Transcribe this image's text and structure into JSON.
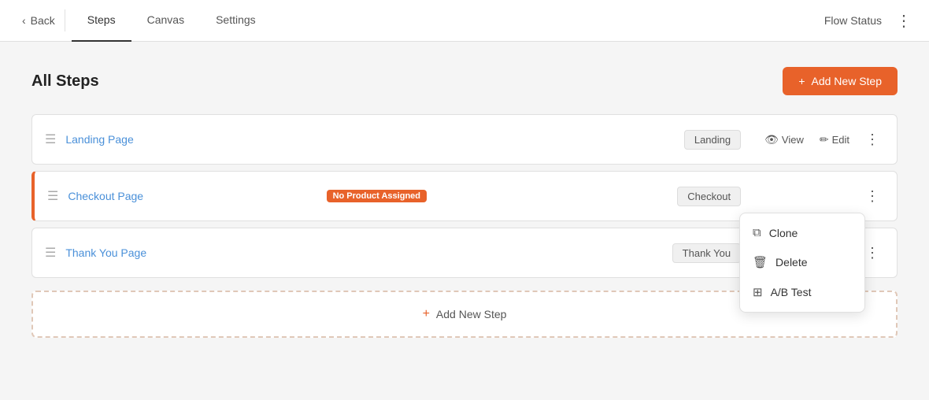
{
  "header": {
    "back_label": "Back",
    "tabs": [
      {
        "label": "Steps",
        "active": true
      },
      {
        "label": "Canvas",
        "active": false
      },
      {
        "label": "Settings",
        "active": false
      }
    ],
    "flow_status_label": "Flow Status",
    "more_icon": "⋮"
  },
  "main": {
    "section_title": "All Steps",
    "add_btn_label": "Add New Step",
    "steps": [
      {
        "id": "landing",
        "name": "Landing Page",
        "type": "Landing",
        "has_warning": false,
        "warning_text": "",
        "show_dropdown": false
      },
      {
        "id": "checkout",
        "name": "Checkout Page",
        "type": "Checkout",
        "has_warning": true,
        "warning_text": "No Product Assigned",
        "show_dropdown": true
      },
      {
        "id": "thankyou",
        "name": "Thank You Page",
        "type": "Thank You",
        "has_warning": false,
        "warning_text": "",
        "show_dropdown": false
      }
    ],
    "dropdown_items": [
      {
        "label": "Clone",
        "icon": "⧉"
      },
      {
        "label": "Delete",
        "icon": "🗑"
      },
      {
        "label": "A/B Test",
        "icon": "⊞"
      }
    ],
    "actions": {
      "view_label": "View",
      "edit_label": "Edit"
    },
    "add_step_footer_label": "Add New Step"
  }
}
